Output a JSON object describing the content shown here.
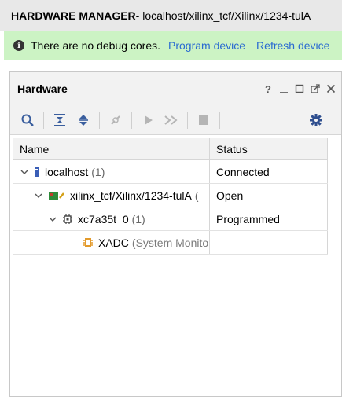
{
  "header": {
    "title": "HARDWARE MANAGER",
    "path": " - localhost/xilinx_tcf/Xilinx/1234-tulA"
  },
  "banner": {
    "message": "There are no debug cores.",
    "program_link": "Program device",
    "refresh_link": "Refresh device"
  },
  "panel": {
    "title": "Hardware",
    "help_glyph": "?"
  },
  "table": {
    "columns": [
      "Name",
      "Status"
    ],
    "rows": [
      {
        "name": "localhost",
        "count": "(1)",
        "status": "Connected"
      },
      {
        "name": "xilinx_tcf/Xilinx/1234-tulA",
        "count": "(",
        "status": "Open"
      },
      {
        "name": "xc7a35t_0",
        "count": "(1)",
        "status": "Programmed"
      },
      {
        "name": "XADC",
        "extra": "(System Monitor)",
        "status": ""
      }
    ]
  },
  "colors": {
    "banner_bg": "#ccf3c4",
    "link": "#2a6bd1",
    "toolbar_icon_active": "#3a5e9e",
    "settings_icon": "#2f4f8f"
  }
}
